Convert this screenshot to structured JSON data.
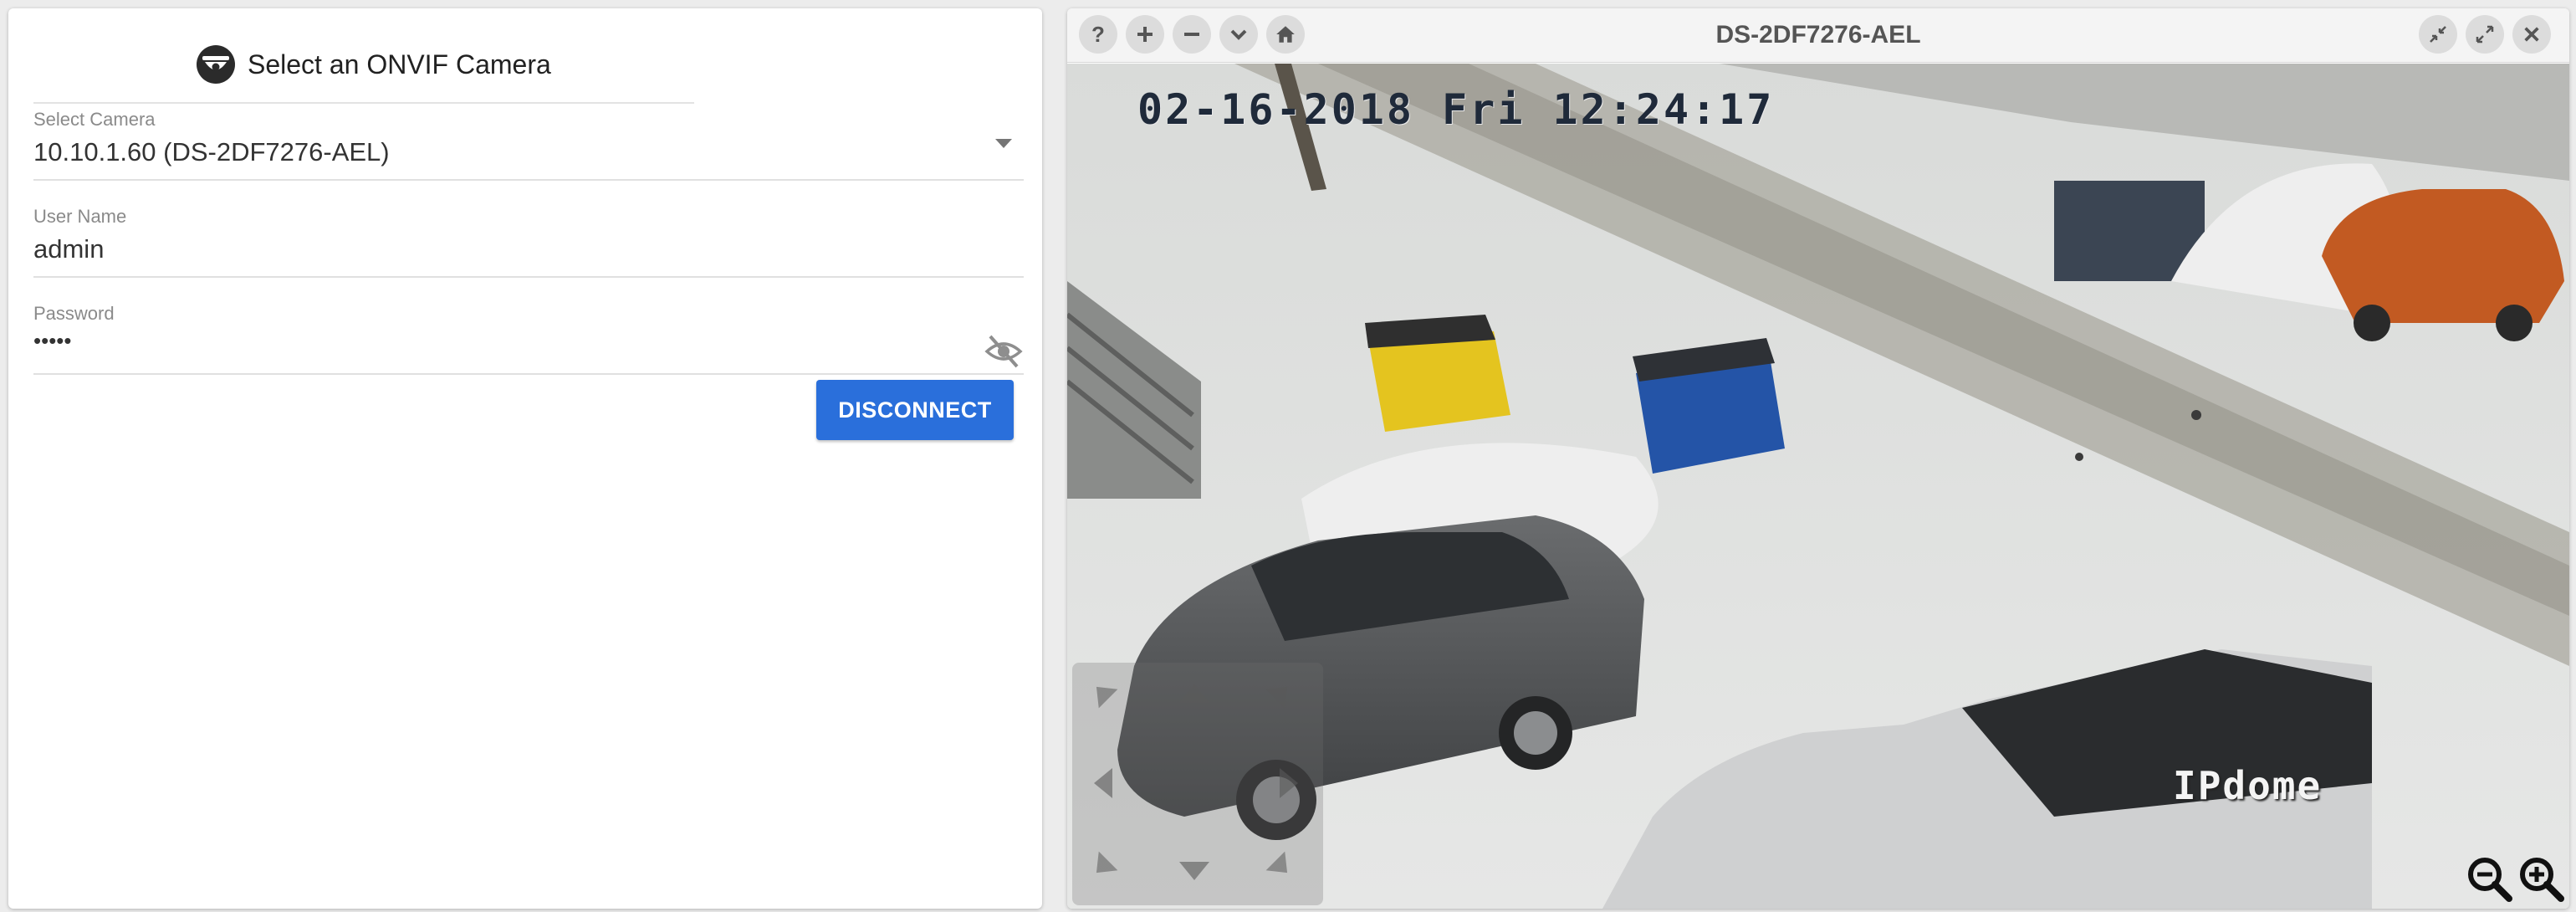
{
  "left_panel": {
    "title": "Select an ONVIF Camera",
    "select_camera": {
      "label": "Select Camera",
      "value": "10.10.1.60 (DS-2DF7276-AEL)"
    },
    "user_name": {
      "label": "User Name",
      "value": "admin"
    },
    "password": {
      "label": "Password",
      "value": "•••••"
    },
    "disconnect_label": "DISCONNECT"
  },
  "right_panel": {
    "title": "DS-2DF7276-AEL",
    "toolbar_left": [
      "help-icon",
      "plus-icon",
      "minus-icon",
      "chevron-down-icon",
      "home-icon"
    ],
    "toolbar_right": [
      "shrink-icon",
      "expand-icon",
      "close-icon"
    ],
    "video": {
      "timestamp": "02-16-2018 Fri 12:24:17",
      "camera_label": "IPdome"
    },
    "zoom_controls": [
      "zoom-out-icon",
      "zoom-in-icon"
    ]
  },
  "colors": {
    "accent": "#2a6fdb",
    "panel_bg": "#ffffff",
    "page_bg": "#ececec"
  }
}
